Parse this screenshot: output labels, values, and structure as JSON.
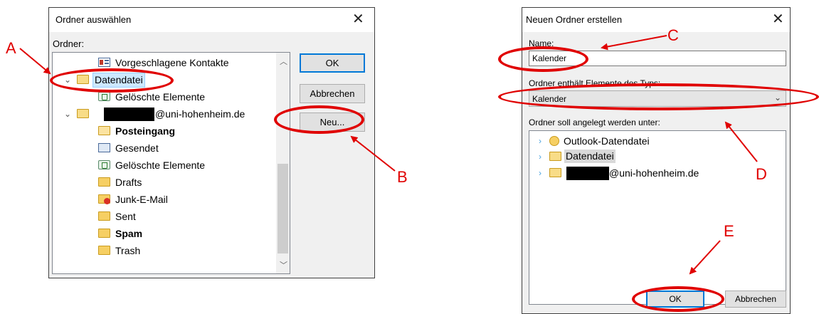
{
  "left_dialog": {
    "title": "Ordner auswählen",
    "close": "✕",
    "folder_label": "Ordner:",
    "tree": [
      {
        "label": "Vorgeschlagene Kontakte",
        "icon": "contacts-icon"
      },
      {
        "label": "Datendatei",
        "icon": "datafile-icon"
      },
      {
        "label": "Gelöschte Elemente",
        "icon": "deleted-items-icon"
      },
      {
        "label": "@uni-hohenheim.de",
        "icon": "account-icon"
      },
      {
        "label": "Posteingang",
        "icon": "inbox-icon"
      },
      {
        "label": "Gesendet",
        "icon": "sent-icon"
      },
      {
        "label": "Gelöschte Elemente",
        "icon": "deleted-items-icon"
      },
      {
        "label": "Drafts",
        "icon": "folder-icon"
      },
      {
        "label": "Junk-E-Mail",
        "icon": "junk-icon"
      },
      {
        "label": "Sent",
        "icon": "folder-icon"
      },
      {
        "label": "Spam",
        "icon": "folder-icon"
      },
      {
        "label": "Trash",
        "icon": "folder-icon"
      }
    ],
    "ok": "OK",
    "cancel": "Abbrechen",
    "new": "Neu..."
  },
  "right_dialog": {
    "title": "Neuen Ordner erstellen",
    "close": "✕",
    "name_label": "Name:",
    "name_value": "Kalender",
    "type_label": "Ordner enthält Elemente des Typs:",
    "type_value": "Kalender",
    "location_label": "Ordner soll angelegt werden unter:",
    "tree": [
      {
        "label": "Outlook-Datendatei",
        "icon": "outlook-datafile-icon"
      },
      {
        "label": "Datendatei",
        "icon": "datafile-icon"
      },
      {
        "label": "@uni-hohenheim.de",
        "icon": "account-icon"
      }
    ],
    "ok": "OK",
    "cancel": "Abbrechen"
  },
  "annotations": {
    "a": "A",
    "b": "B",
    "c": "C",
    "d": "D",
    "e": "E"
  },
  "colors": {
    "annotation": "#e00000",
    "selection": "#cce8ff",
    "focus": "#0078d7"
  }
}
